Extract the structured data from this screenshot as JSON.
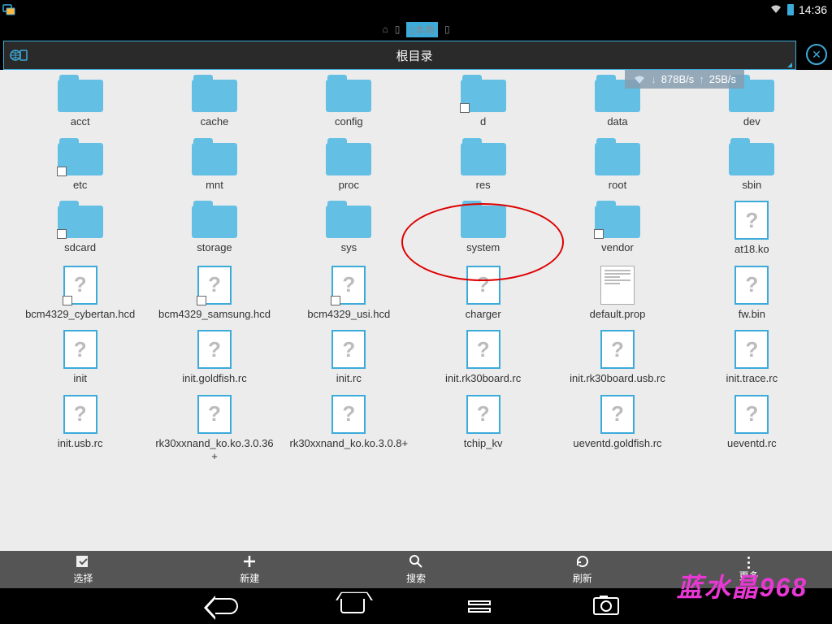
{
  "status": {
    "time": "14:36"
  },
  "tabs": {
    "home_glyph": "⌂",
    "sd_glyph": "▯",
    "local_prefix": "▯",
    "local_label": "本地",
    "sd2_glyph": "▯"
  },
  "path": {
    "title": "根目录"
  },
  "speed": {
    "down": "878B/s",
    "up": "25B/s"
  },
  "items": [
    {
      "name": "acct",
      "type": "folder"
    },
    {
      "name": "cache",
      "type": "folder"
    },
    {
      "name": "config",
      "type": "folder"
    },
    {
      "name": "d",
      "type": "folder",
      "link": true
    },
    {
      "name": "data",
      "type": "folder"
    },
    {
      "name": "dev",
      "type": "folder"
    },
    {
      "name": "etc",
      "type": "folder",
      "link": true
    },
    {
      "name": "mnt",
      "type": "folder"
    },
    {
      "name": "proc",
      "type": "folder"
    },
    {
      "name": "res",
      "type": "folder"
    },
    {
      "name": "root",
      "type": "folder"
    },
    {
      "name": "sbin",
      "type": "folder"
    },
    {
      "name": "sdcard",
      "type": "folder",
      "link": true
    },
    {
      "name": "storage",
      "type": "folder"
    },
    {
      "name": "sys",
      "type": "folder"
    },
    {
      "name": "system",
      "type": "folder"
    },
    {
      "name": "vendor",
      "type": "folder",
      "link": true
    },
    {
      "name": "at18.ko",
      "type": "file"
    },
    {
      "name": "bcm4329_cybertan.hcd",
      "type": "file",
      "link": true
    },
    {
      "name": "bcm4329_samsung.hcd",
      "type": "file",
      "link": true
    },
    {
      "name": "bcm4329_usi.hcd",
      "type": "file",
      "link": true
    },
    {
      "name": "charger",
      "type": "file"
    },
    {
      "name": "default.prop",
      "type": "text"
    },
    {
      "name": "fw.bin",
      "type": "file"
    },
    {
      "name": "init",
      "type": "file"
    },
    {
      "name": "init.goldfish.rc",
      "type": "file"
    },
    {
      "name": "init.rc",
      "type": "file"
    },
    {
      "name": "init.rk30board.rc",
      "type": "file"
    },
    {
      "name": "init.rk30board.usb.rc",
      "type": "file"
    },
    {
      "name": "init.trace.rc",
      "type": "file"
    },
    {
      "name": "init.usb.rc",
      "type": "file"
    },
    {
      "name": "rk30xxnand_ko.ko.3.0.36+",
      "type": "file"
    },
    {
      "name": "rk30xxnand_ko.ko.3.0.8+",
      "type": "file"
    },
    {
      "name": "tchip_kv",
      "type": "file"
    },
    {
      "name": "ueventd.goldfish.rc",
      "type": "file"
    },
    {
      "name": "ueventd.rc",
      "type": "file"
    }
  ],
  "toolbar": {
    "select": "选择",
    "new": "新建",
    "search": "搜索",
    "refresh": "刷新",
    "more": "更多"
  },
  "watermark": {
    "text": "蓝水晶",
    "num": "968"
  }
}
